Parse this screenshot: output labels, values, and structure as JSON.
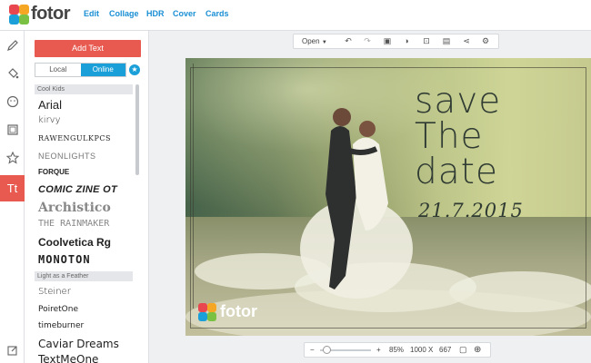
{
  "app": {
    "logo_text": "fotor"
  },
  "nav": [
    {
      "label": "Edit"
    },
    {
      "label": "Collage"
    },
    {
      "label": "HDR"
    },
    {
      "label": "Cover"
    },
    {
      "label": "Cards"
    }
  ],
  "leftbar": {
    "items": [
      {
        "icon": "pencil-icon"
      },
      {
        "icon": "paint-bucket-icon"
      },
      {
        "icon": "sticker-face-icon"
      },
      {
        "icon": "frame-icon"
      },
      {
        "icon": "star-icon"
      },
      {
        "icon": "text-icon",
        "label": "Tt",
        "active": true
      },
      {
        "icon": "edit-note-icon"
      }
    ]
  },
  "panel": {
    "add_text_label": "Add Text",
    "tabs": [
      {
        "label": "Local"
      },
      {
        "label": "Online"
      }
    ],
    "sections": [
      {
        "title": "Cool Kids",
        "fonts": [
          {
            "label": "Arial"
          },
          {
            "label": "kirvy"
          },
          {
            "label": "RAWENGULKPCS"
          },
          {
            "label": "NEONLIGHTS"
          },
          {
            "label": "FORQUE"
          },
          {
            "label": "COMIC ZINE OT"
          },
          {
            "label": "Archistico"
          },
          {
            "label": "THE RAINMAKER"
          },
          {
            "label": "Coolvetica Rg",
            "premium": true
          },
          {
            "label": "MONOTON",
            "premium": true
          }
        ]
      },
      {
        "title": "Light as a Feather",
        "fonts": [
          {
            "label": "Steiner"
          },
          {
            "label": "PoiretOne"
          },
          {
            "label": "timeburner"
          },
          {
            "label": "Caviar Dreams"
          },
          {
            "label": "TextMeOne"
          }
        ]
      }
    ]
  },
  "toolbar": {
    "open_label": "Open",
    "icons": [
      "undo-icon",
      "redo-icon",
      "compare-icon",
      "circle-half-icon",
      "screenshot-icon",
      "save-icon",
      "share-icon",
      "settings-icon"
    ]
  },
  "canvas": {
    "headline_lines": [
      "save",
      "The",
      "date"
    ],
    "date_text": "21.7.2015",
    "watermark": "fotor"
  },
  "zoom": {
    "minus": "−",
    "plus": "+",
    "level_pct": "85%",
    "width": "1000",
    "times": "X",
    "height": "667",
    "slider_fraction": 0.05
  },
  "colors": {
    "accent": "#e85a4f",
    "link": "#1a8fd4",
    "tab": "#1a9fd8"
  }
}
